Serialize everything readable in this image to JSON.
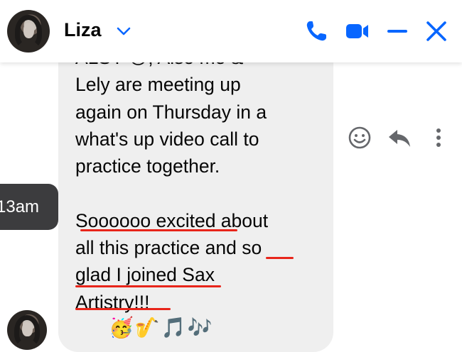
{
  "header": {
    "contact_name": "Liza",
    "icons": [
      "chevron-down-icon",
      "phone-icon",
      "video-camera-icon",
      "minimize-icon",
      "close-icon"
    ],
    "accent_color": "#0866ff"
  },
  "message": {
    "text": "AZSY 😊, Also me & Lely are meeting up again on Thursday in a what's up video call to practice together.\n\nSoooooo excited about all this practice and so glad I joined Sax Artistry!!!",
    "visible_lines": [
      "ALSY 😊, Also me &",
      "Lely are meeting up",
      "again on Thursday in a",
      "what's up video call to",
      "practice together.",
      "",
      "Soooooo excited about",
      "all this practice and so",
      "glad I joined Sax",
      "Artistry!!!"
    ],
    "emojis": "🥳🎷🎵🎶",
    "bubble_color": "#efefef",
    "underline_color": "#e8251a"
  },
  "timestamp": "13am",
  "message_actions": [
    "smiley-face-icon",
    "reply-icon",
    "more-options-icon"
  ]
}
